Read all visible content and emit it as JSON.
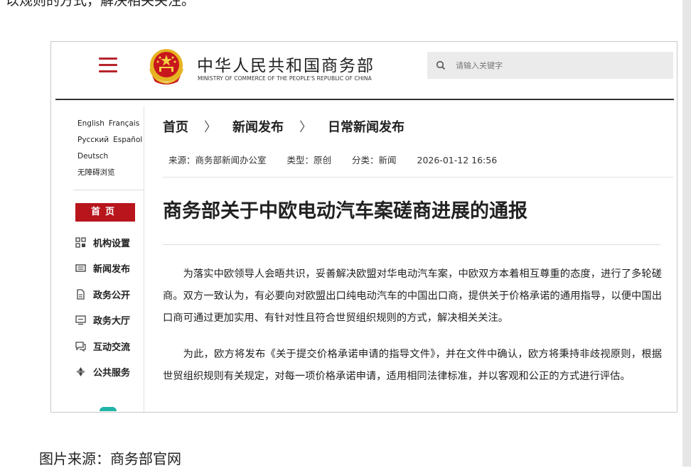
{
  "top_snippet": "以规则的方式，解决相关关注。",
  "header": {
    "logo_cn": "中华人民共和国商务部",
    "logo_en": "MINISTRY OF COMMERCE OF THE PEOPLE'S REPUBLIC OF CHINA",
    "search_placeholder": "请输入关键字"
  },
  "sidebar": {
    "languages": [
      [
        "English",
        "Français"
      ],
      [
        "Русский",
        "Español"
      ],
      [
        "Deutsch"
      ]
    ],
    "accessibility": "无障碍浏览",
    "home": "首页",
    "items": [
      {
        "label": "机构设置",
        "icon": "org-grid-icon"
      },
      {
        "label": "新闻发布",
        "icon": "newspaper-icon"
      },
      {
        "label": "政务公开",
        "icon": "document-icon"
      },
      {
        "label": "政务大厅",
        "icon": "monitor-icon"
      },
      {
        "label": "互动交流",
        "icon": "chat-icon"
      },
      {
        "label": "公共服务",
        "icon": "service-icon"
      }
    ]
  },
  "breadcrumb": [
    "首页",
    "新闻发布",
    "日常新闻发布"
  ],
  "breadcrumb_sep": "〉",
  "meta": {
    "source": "来源：商务部新闻办公室",
    "type": "类型：原创",
    "category": "分类：新闻",
    "datetime": "2026-01-12 16:56"
  },
  "article": {
    "title": "商务部关于中欧电动汽车案磋商进展的通报",
    "paragraphs": [
      "为落实中欧领导人会晤共识，妥善解决欧盟对华电动汽车案，中欧双方本着相互尊重的态度，进行了多轮磋商。双方一致认为，有必要向对欧盟出口纯电动汽车的中国出口商，提供关于价格承诺的通用指导，以便中国出口商可通过更加实用、有针对性且符合世贸组织规则的方式，解决相关关注。",
      "为此，欧方将发布《关于提交价格承诺申请的指导文件》，并在文件中确认，欧方将秉持非歧视原则，根据世贸组织规则有关规定，对每一项价格承诺申请，适用相同法律标准，并以客观和公正的方式进行评估。"
    ]
  },
  "caption": "图片来源：商务部官网",
  "colors": {
    "brand_red": "#b8151c",
    "menu_red": "#b5252b",
    "teal": "#20b5a6"
  }
}
